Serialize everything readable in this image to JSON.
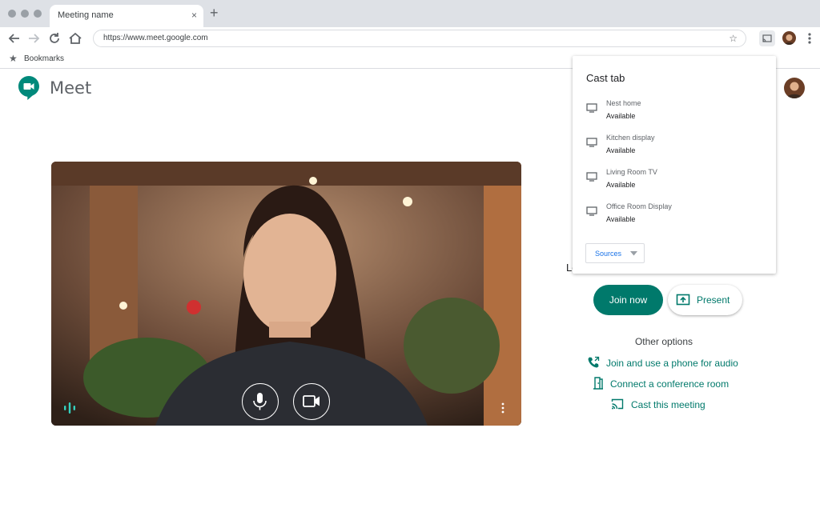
{
  "browser": {
    "tab_title": "Meeting name",
    "tab_close": "×",
    "new_tab": "+",
    "url": "https://www.meet.google.com",
    "bookmark_star": "★",
    "url_star": "☆",
    "bookmarks_label": "Bookmarks"
  },
  "page": {
    "app_name": "Meet",
    "ready_text_partial": "Lo",
    "join_label": "Join now",
    "present_label": "Present",
    "other_options_label": "Other options",
    "options": [
      {
        "label": "Join and use a phone for audio",
        "icon": "phone-icon"
      },
      {
        "label": "Connect a conference room",
        "icon": "door-icon"
      },
      {
        "label": "Cast this meeting",
        "icon": "cast-icon"
      }
    ]
  },
  "cast_popup": {
    "title": "Cast tab",
    "devices": [
      {
        "name": "Nest home",
        "status": "Available"
      },
      {
        "name": "Kitchen display",
        "status": "Available"
      },
      {
        "name": "Living Room TV",
        "status": "Available"
      },
      {
        "name": "Office Room Display",
        "status": "Available"
      }
    ],
    "sources_label": "Sources"
  },
  "colors": {
    "accent": "#00796b",
    "chrome": "#dee1e6",
    "link_blue": "#1a73e8"
  }
}
